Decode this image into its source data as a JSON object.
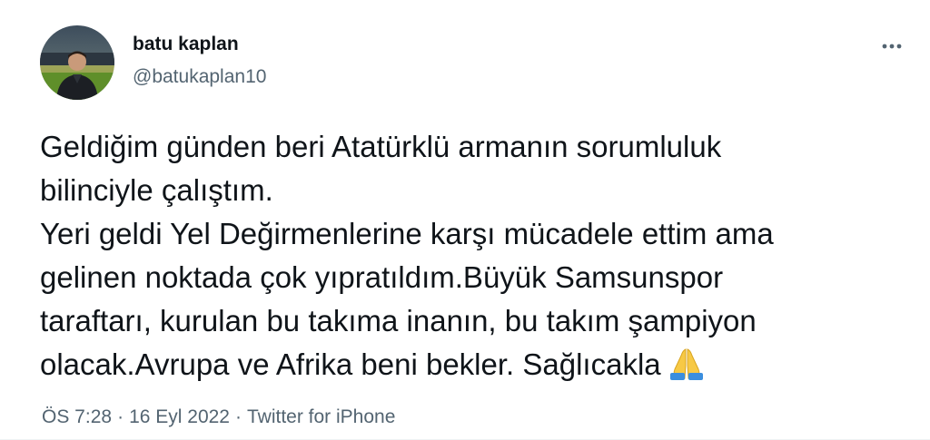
{
  "user": {
    "display_name": "batu kaplan",
    "handle": "@batukaplan10"
  },
  "tweet": {
    "lines": [
      "Geldiğim günden beri Atatürklü armanın sorumluluk",
      "bilinciyle çalıştım.",
      "Yeri geldi Yel Değirmenlerine karşı mücadele ettim ama",
      "gelinen noktada çok yıpratıldım.Büyük Samsunspor",
      "taraftarı, kurulan bu takıma inanın, bu takım şampiyon",
      "olacak.Avrupa ve Afrika beni bekler. Sağlıcakla"
    ],
    "emoji": "folded-hands-emoji"
  },
  "meta": {
    "time": "ÖS 7:28",
    "separator": "·",
    "date": "16 Eyl 2022",
    "source": "Twitter for iPhone"
  },
  "icons": {
    "more": "more-horizontal-icon"
  },
  "colors": {
    "text": "#0f1419",
    "secondary": "#536471"
  }
}
